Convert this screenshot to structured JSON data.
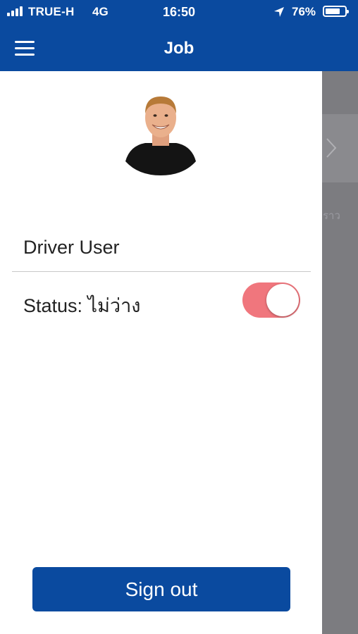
{
  "status_bar": {
    "carrier": "TRUE-H",
    "network": "4G",
    "time": "16:50",
    "battery_percent": "76%",
    "battery_level": 0.76
  },
  "nav": {
    "title": "Job",
    "menu_icon": "hamburger-menu-icon"
  },
  "drawer": {
    "user_name": "Driver User",
    "status_label": "Status: ไม่ว่าง",
    "status_toggle_on": true,
    "toggle_color": "#f0767d",
    "sign_out_label": "Sign out"
  },
  "colors": {
    "primary": "#0a4a9f",
    "overlay": "#7c7c80"
  }
}
